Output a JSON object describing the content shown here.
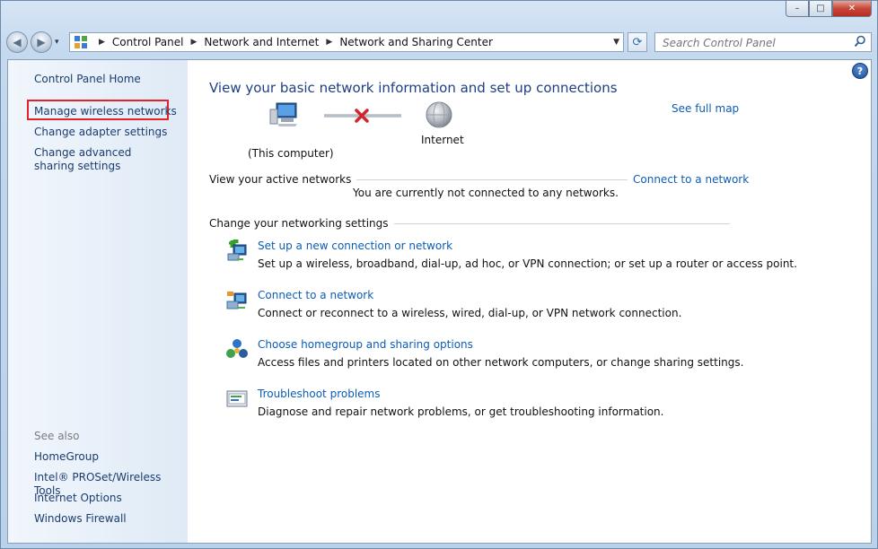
{
  "window": {
    "minimize_glyph": "–",
    "maximize_glyph": "□",
    "close_glyph": "✕"
  },
  "navbar": {
    "breadcrumb": [
      "Control Panel",
      "Network and Internet",
      "Network and Sharing Center"
    ],
    "search_placeholder": "Search Control Panel"
  },
  "sidebar": {
    "home": "Control Panel Home",
    "items": [
      "Manage wireless networks",
      "Change adapter settings",
      "Change advanced sharing settings"
    ],
    "see_also_title": "See also",
    "see_also": [
      "HomeGroup",
      "Intel® PROSet/Wireless Tools",
      "Internet Options",
      "Windows Firewall"
    ]
  },
  "main": {
    "title": "View your basic network information and set up connections",
    "see_full_map": "See full map",
    "map": {
      "computer_label": "(This computer)",
      "internet_label": "Internet"
    },
    "active_networks": {
      "heading": "View your active networks",
      "connect_link": "Connect to a network",
      "status": "You are currently not connected to any networks."
    },
    "settings": {
      "heading": "Change your networking settings",
      "tasks": [
        {
          "icon": "new-connection-icon",
          "label": "Set up a new connection or network",
          "desc": "Set up a wireless, broadband, dial-up, ad hoc, or VPN connection; or set up a router or access point."
        },
        {
          "icon": "connect-network-icon",
          "label": "Connect to a network",
          "desc": "Connect or reconnect to a wireless, wired, dial-up, or VPN network connection."
        },
        {
          "icon": "homegroup-icon",
          "label": "Choose homegroup and sharing options",
          "desc": "Access files and printers located on other network computers, or change sharing settings."
        },
        {
          "icon": "troubleshoot-icon",
          "label": "Troubleshoot problems",
          "desc": "Diagnose and repair network problems, or get troubleshooting information."
        }
      ]
    }
  },
  "colors": {
    "link": "#0c5cb5",
    "title": "#1e3f82",
    "highlight_box": "#e3222c",
    "sidebar_bg": "#e6eff9"
  }
}
